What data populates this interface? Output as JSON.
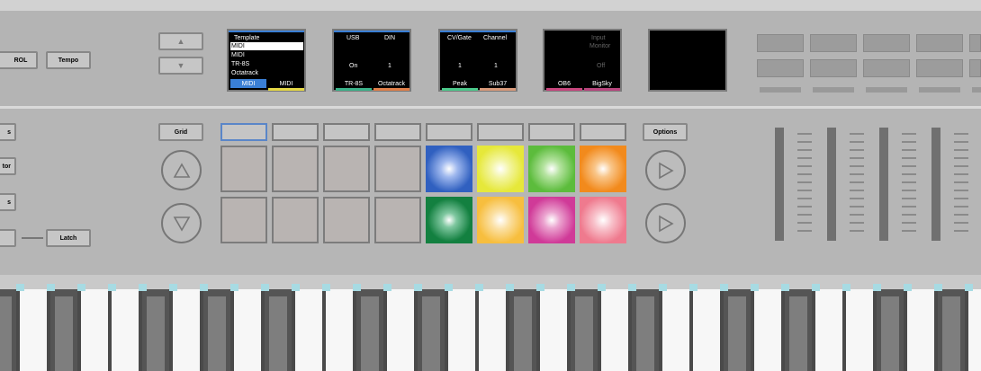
{
  "top_buttons": {
    "left_partial": "ROL",
    "tempo": "Tempo"
  },
  "arrows": {
    "up": "▲",
    "down": "▼"
  },
  "screen1": {
    "title": "Template",
    "items": [
      "MIDI",
      "MIDI",
      "TR-8S",
      "Octatrack"
    ],
    "tab_active": "MIDI",
    "tab_inactive": "MIDI"
  },
  "screen2": {
    "headers": [
      "USB",
      "DIN"
    ],
    "values": [
      "On",
      "1"
    ],
    "tabs": [
      "TR-8S",
      "Octatrack"
    ]
  },
  "screen3": {
    "headers": [
      "CV/Gate",
      "Channel"
    ],
    "values": [
      "1",
      "1"
    ],
    "tabs": [
      "Peak",
      "Sub37"
    ]
  },
  "screen4": {
    "title_line1": "Input",
    "title_line2": "Monitor",
    "value": "Off",
    "tabs": [
      "OB6",
      "BigSky"
    ]
  },
  "left_buttons": [
    "s",
    "tor",
    "s",
    ""
  ],
  "latch_label": "Latch",
  "grid_label": "Grid",
  "options_label": "Options",
  "colors": {
    "pad_blue": "#3060c0",
    "pad_yellow": "#e6e83a",
    "pad_green": "#5cbc3c",
    "pad_orange": "#f28a1c",
    "pad_darkgreen": "#138040",
    "pad_lightorange": "#f7be3e",
    "pad_magenta": "#d03a98",
    "pad_pink": "#ef7a8e",
    "screen_tab_blue": "#3a7fd5",
    "screen_tab_yellow": "#e6d846"
  }
}
